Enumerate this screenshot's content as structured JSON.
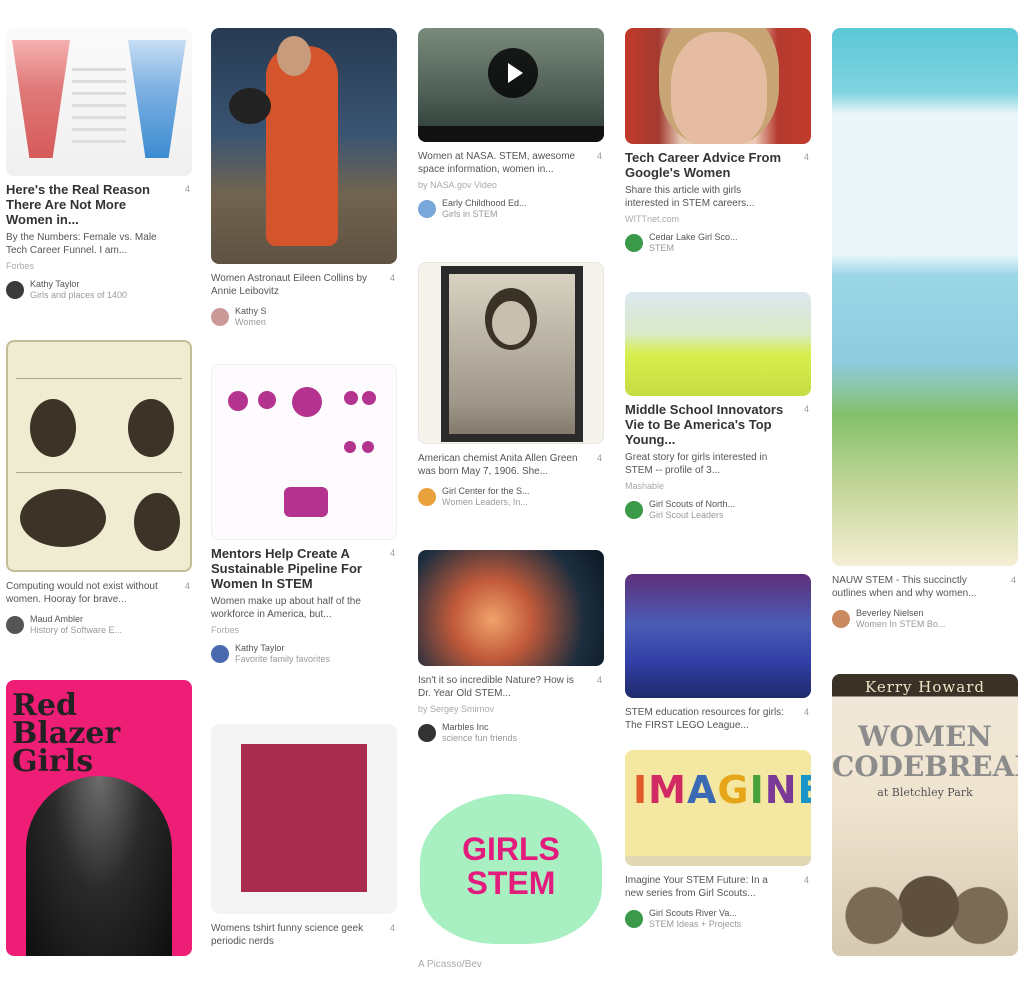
{
  "pins": {
    "p1": {
      "title": "Here's the Real Reason There Are Not More Women in...",
      "count": "4",
      "desc": "By the Numbers: Female vs. Male Tech Career Funnel. I am...",
      "src": "Forbes",
      "user": "Kathy Taylor",
      "board": "Girls and places of 1400"
    },
    "p2": {
      "desc": "Women Astronaut Eileen Collins by Annie Leibovitz",
      "count": "4",
      "user": "Kathy S",
      "board": "Women"
    },
    "p3": {
      "desc": "Women at NASA. STEM, awesome space information, women in...",
      "count": "4",
      "src": "by NASA.gov Video",
      "user": "Early Childhood Ed...",
      "board": "Girls in STEM"
    },
    "p4": {
      "title": "Tech Career Advice From Google's Women",
      "count": "4",
      "desc": "Share this article with girls interested in STEM careers...",
      "src": "WITTnet.com",
      "user": "Cedar Lake Girl Sco...",
      "board": "STEM"
    },
    "p5": {
      "desc": "Computing would not exist without women. Hooray for brave...",
      "count": "4",
      "user": "Maud Ambler",
      "board": "History of Software E..."
    },
    "p6": {
      "title": "Mentors Help Create A Sustainable Pipeline For Women In STEM",
      "count": "4",
      "desc": "Women make up about half of the workforce in America, but...",
      "src": "Forbes",
      "user": "Kathy Taylor",
      "board": "Favorite family favorites"
    },
    "p7": {
      "desc": "American chemist Anita Allen Green was born May 7, 1906. She...",
      "count": "4",
      "user": "Girl Center for the S...",
      "board": "Women Leaders, In..."
    },
    "p8": {
      "title": "Middle School Innovators Vie to Be America's Top Young...",
      "count": "4",
      "desc": "Great story for girls interested in STEM -- profile of 3...",
      "src": "Mashable",
      "user": "Girl Scouts of North...",
      "board": "Girl Scout Leaders"
    },
    "p9": {
      "desc": "NAUW STEM - This succinctly outlines when and why women...",
      "count": "4",
      "user": "Beverley Nielsen",
      "board": "Women In STEM Bo..."
    },
    "p10": {
      "desc": "Isn't it so incredible Nature? How is Dr. Year Old STEM...",
      "count": "4",
      "src": "by Sergey Smirnov",
      "user": "Marbles Inc",
      "board": "science fun friends"
    },
    "p11": {
      "desc": "STEM education resources for girls: The FIRST LEGO League...",
      "count": "4",
      "user": "",
      "board": ""
    },
    "p12": {
      "desc": "Womens tshirt funny science geek periodic nerds",
      "count": "4",
      "user": "",
      "board": ""
    },
    "p13": {
      "desc": "Imagine Your STEM Future: In a new series from Girl Scouts...",
      "count": "4",
      "user": "Girl Scouts River Va...",
      "board": "STEM Ideas + Projects"
    },
    "p14": {
      "desc": "A Picasso/Bev"
    }
  },
  "images": {
    "blazer_title": "Red Blazer Girls",
    "heart_text": [
      "GIRLS",
      "STEM"
    ],
    "imagine_letters": [
      "I",
      "M",
      "A",
      "G",
      "I",
      "N",
      "E"
    ],
    "book_author": "Kerry Howard",
    "book_title": [
      "WOMEN",
      "CODEBREAKERS"
    ],
    "book_sub": "at Bletchley Park"
  },
  "colors": {
    "pin_pink": "#ee1d76",
    "heart_mint": "#a8f0c2",
    "heart_text": "#e21b7c"
  },
  "icons": {
    "video_play": "play-icon"
  }
}
